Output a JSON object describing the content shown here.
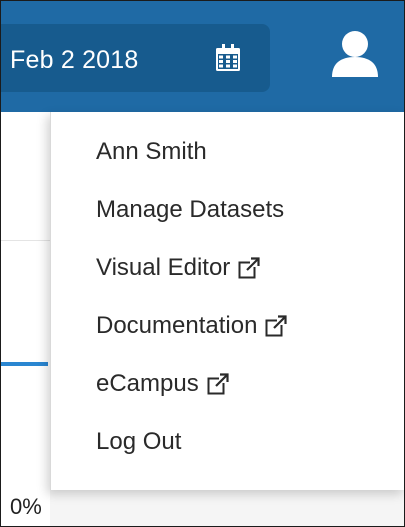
{
  "header": {
    "date": "Feb 2 2018",
    "calendar_icon": "calendar-icon",
    "user_icon": "user-icon",
    "colors": {
      "topbar": "#1f6aa5",
      "date_pill": "#175b8e"
    }
  },
  "menu": {
    "user_name": "Ann Smith",
    "items": [
      {
        "label": "Manage Datasets",
        "external": false
      },
      {
        "label": "Visual Editor",
        "external": true
      },
      {
        "label": "Documentation",
        "external": true
      },
      {
        "label": "eCampus",
        "external": true
      },
      {
        "label": "Log Out",
        "external": false
      }
    ],
    "external_icon": "external-link-icon"
  },
  "background": {
    "percent": "0%",
    "accent": "#2a86d1"
  }
}
